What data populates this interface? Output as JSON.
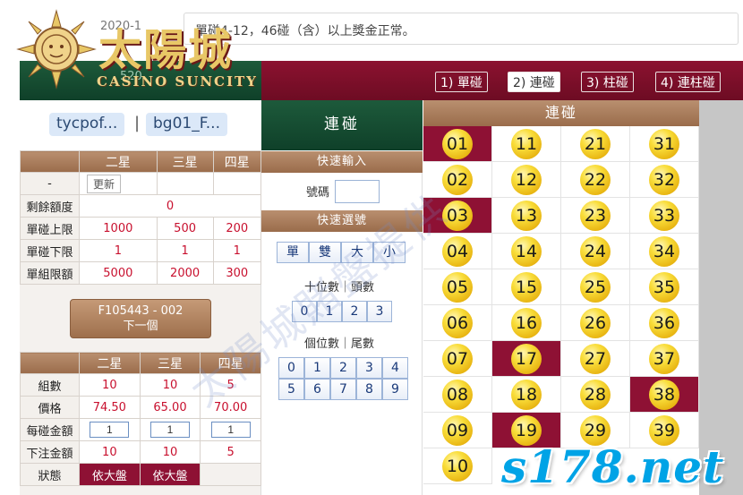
{
  "header": {
    "date_partial": "2020-1",
    "marquee": "單碰4-12，46碰（含）以上獎金正常。",
    "logo_title": "太陽城",
    "logo_sub": "CASINO SUNCITY",
    "logo_num": "520"
  },
  "user_tabs": [
    "tycpof...",
    "|",
    "bg01_F..."
  ],
  "limits": {
    "columns": [
      "",
      "二星",
      "三星",
      "四星"
    ],
    "update_label": "更新",
    "dash": "-",
    "rows": [
      {
        "label": "剩餘額度",
        "values": [
          "0"
        ]
      },
      {
        "label": "單碰上限",
        "values": [
          "1000",
          "500",
          "200"
        ]
      },
      {
        "label": "單碰下限",
        "values": [
          "1",
          "1",
          "1"
        ]
      },
      {
        "label": "單組限額",
        "values": [
          "5000",
          "2000",
          "300"
        ]
      }
    ]
  },
  "next_button": {
    "line1": "F105443 - 002",
    "line2": "下一個"
  },
  "bets": {
    "columns": [
      "",
      "二星",
      "三星",
      "四星"
    ],
    "rows": [
      {
        "label": "組數",
        "values": [
          "10",
          "10",
          "5"
        ]
      },
      {
        "label": "價格",
        "values": [
          "74.50",
          "65.00",
          "70.00"
        ]
      },
      {
        "label": "每碰金額",
        "values": [
          "1",
          "1",
          "1"
        ]
      },
      {
        "label": "下注金額",
        "values": [
          "10",
          "10",
          "5"
        ]
      },
      {
        "label": "狀態",
        "values": [
          "依大盤",
          "依大盤"
        ]
      }
    ]
  },
  "modes": [
    "1) 單碰",
    "2) 連碰",
    "3) 柱碰",
    "4) 連柱碰"
  ],
  "active_mode": 1,
  "middle": {
    "title": "連碰",
    "quick_input": "快速輸入",
    "number_label": "號碼",
    "quick_select": "快速選號",
    "parity_buttons": [
      "單",
      "雙",
      "大",
      "小"
    ],
    "tens_label": "十位數｜頭數",
    "tens_buttons": [
      "0",
      "1",
      "2",
      "3"
    ],
    "units_label": "個位數｜尾數",
    "units_buttons": [
      "0",
      "1",
      "2",
      "3",
      "4",
      "5",
      "6",
      "7",
      "8",
      "9"
    ]
  },
  "grid": {
    "title": "連碰",
    "numbers": [
      "01",
      "11",
      "21",
      "31",
      "02",
      "12",
      "22",
      "32",
      "03",
      "13",
      "23",
      "33",
      "04",
      "14",
      "24",
      "34",
      "05",
      "15",
      "25",
      "35",
      "06",
      "16",
      "26",
      "36",
      "07",
      "17",
      "27",
      "37",
      "08",
      "18",
      "28",
      "38",
      "09",
      "19",
      "29",
      "39",
      "10"
    ],
    "selected": [
      "01",
      "03",
      "17",
      "19",
      "38"
    ]
  },
  "watermark": "太陽城賭盤提供",
  "site_watermark": "s178.net",
  "colors": {
    "maroon": "#8e1134",
    "green": "#0f4029",
    "tan": "#9a6c4b",
    "ball": "#f9dd3a"
  }
}
